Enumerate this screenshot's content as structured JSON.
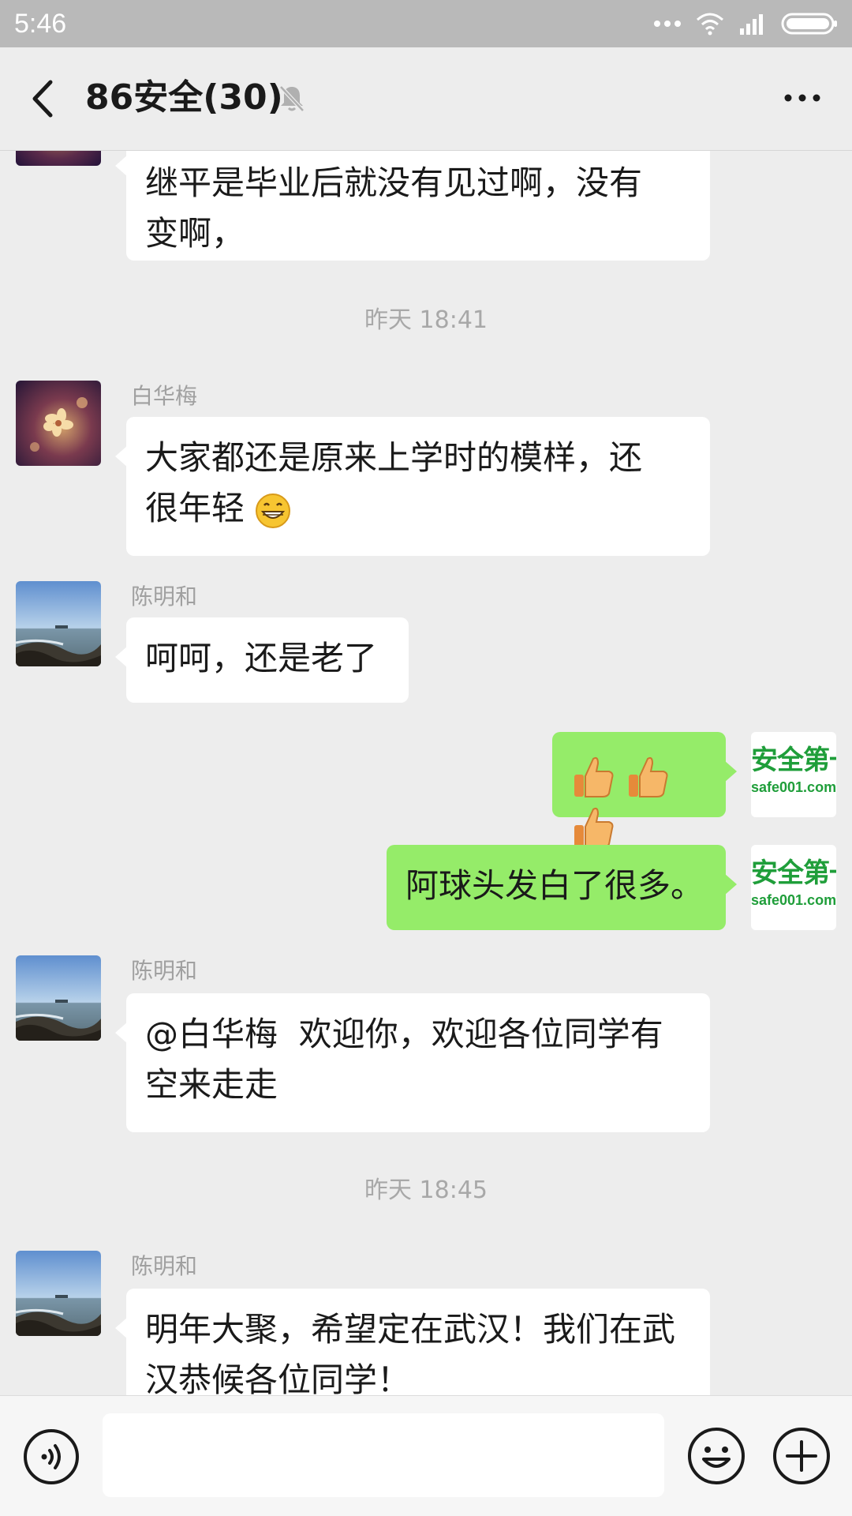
{
  "status_bar": {
    "time": "5:46"
  },
  "header": {
    "title": "86安全(30)"
  },
  "chat": {
    "timestamps": [
      "昨天 18:41",
      "昨天 18:45"
    ],
    "messages": [
      {
        "side": "left",
        "sender": "",
        "text_lines": [
          "继平是毕业后就没有见过啊，没有",
          "变啊，"
        ],
        "avatar": "blossom"
      },
      {
        "side": "left",
        "sender": "白华梅",
        "text_lines": [
          "大家都还是原来上学时的模样，还",
          "很年轻"
        ],
        "emoji": "grinning-face",
        "avatar": "blossom"
      },
      {
        "side": "left",
        "sender": "陈明和",
        "text_lines": [
          "呵呵，还是老了"
        ],
        "avatar": "seascape"
      },
      {
        "side": "right",
        "text_lines": [
          ""
        ],
        "emoji": "thumbs-up x3",
        "avatar": "safe-logo"
      },
      {
        "side": "right",
        "text_lines": [
          "阿球头发白了很多。"
        ],
        "avatar": "safe-logo"
      },
      {
        "side": "left",
        "sender": "陈明和",
        "text_lines": [
          "@白华梅  欢迎你，欢迎各位同学有",
          "空来走走"
        ],
        "avatar": "seascape"
      },
      {
        "side": "left",
        "sender": "陈明和",
        "text_lines": [
          "明年大聚，希望定在武汉！我们在武",
          "汉恭候各位同学！"
        ],
        "avatar": "seascape"
      }
    ],
    "safe_avatar": {
      "top_text": "安全第一",
      "bottom_text": "safe001.com"
    }
  },
  "input_bar": {
    "placeholder": ""
  },
  "icons": {
    "back": "chevron-left-icon",
    "mute": "bell-muted-icon",
    "more": "more-dots-icon",
    "voice": "voice-icon",
    "emoji": "emoji-icon",
    "plus": "plus-circle-icon"
  },
  "colors": {
    "background": "#ededed",
    "bubble_self": "#95ec69",
    "bubble_other": "#ffffff",
    "status_bar": "#b9b9b9"
  }
}
